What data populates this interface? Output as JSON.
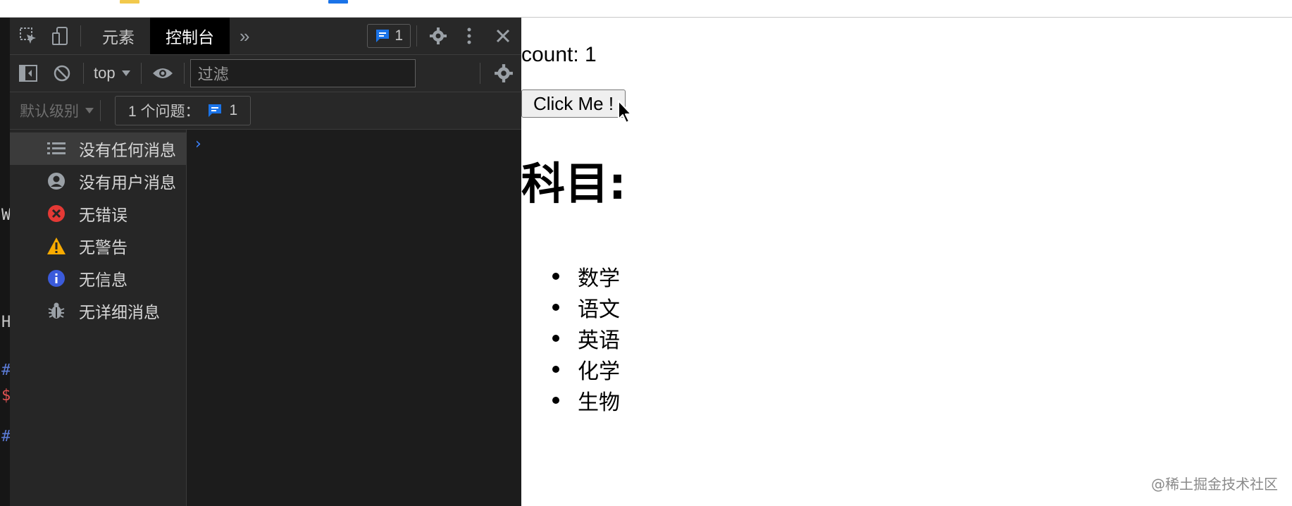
{
  "devtools": {
    "tabs": [
      "元素",
      "控制台"
    ],
    "active_tab": "控制台",
    "more_tabs": "»",
    "issue_count": "1",
    "context": "top",
    "filter_placeholder": "过滤",
    "level": "默认级别",
    "issues_label": "1 个问题：",
    "issues_count": "1",
    "sidebar": [
      {
        "label": "没有任何消息",
        "icon": "list-icon"
      },
      {
        "label": "没有用户消息",
        "icon": "user-icon"
      },
      {
        "label": "无错误",
        "icon": "error-icon"
      },
      {
        "label": "无警告",
        "icon": "warning-icon"
      },
      {
        "label": "无信息",
        "icon": "info-icon"
      },
      {
        "label": "无详细消息",
        "icon": "bug-icon"
      }
    ],
    "prompt": "›"
  },
  "left_edge": [
    "W",
    "H",
    "#",
    "$",
    "#"
  ],
  "page": {
    "count_text": "count: 1",
    "button_label": "Click Me !",
    "heading": "科目:",
    "subjects": [
      "数学",
      "语文",
      "英语",
      "化学",
      "生物"
    ]
  },
  "watermark": "@稀土掘金技术社区",
  "colors": {
    "devtools_bg": "#242424",
    "accent_blue": "#1a73e8",
    "error_red": "#e53935",
    "warning_yellow": "#f9ab00",
    "info_blue": "#3b5bdb"
  }
}
